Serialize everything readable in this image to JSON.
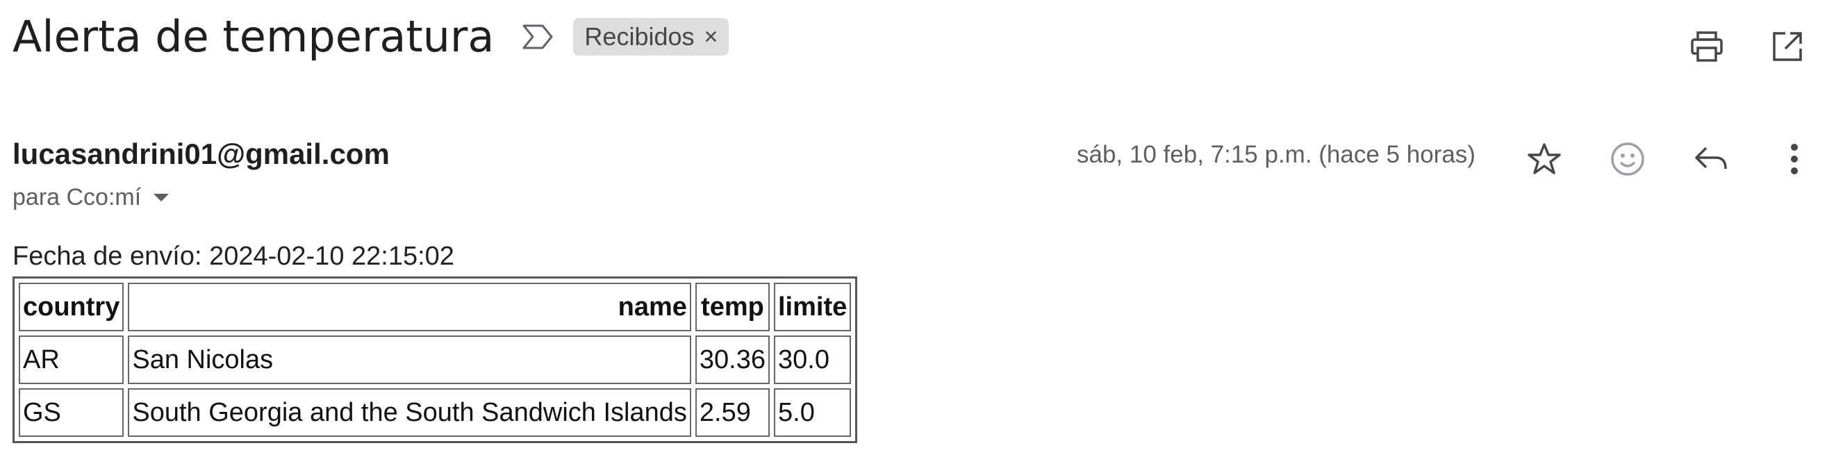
{
  "header": {
    "subject": "Alerta de temperatura",
    "label": "Recibidos",
    "label_close": "×",
    "icons": [
      "importance-marker-icon",
      "print-icon",
      "open-in-new-window-icon"
    ]
  },
  "message": {
    "sender": "lucasandrini01@gmail.com",
    "recipients": "para Cco:mí",
    "date": "sáb, 10 feb, 7:15 p.m. (hace 5 horas)",
    "action_icons": [
      "star-icon",
      "emoji-react-icon",
      "reply-icon",
      "more-vert-icon"
    ],
    "body_line": "Fecha de envío: 2024-02-10 22:15:02",
    "table": {
      "headers": [
        "country",
        "name",
        "temp",
        "limite"
      ],
      "rows": [
        [
          "AR",
          "San Nicolas",
          "30.36",
          "30.0"
        ],
        [
          "GS",
          "South Georgia and the South Sandwich Islands",
          "2.59",
          "5.0"
        ]
      ]
    }
  },
  "colors": {
    "text_primary": "#1f1f1f",
    "text_secondary": "#5e5e5e",
    "chip_bg": "#dddddd"
  }
}
